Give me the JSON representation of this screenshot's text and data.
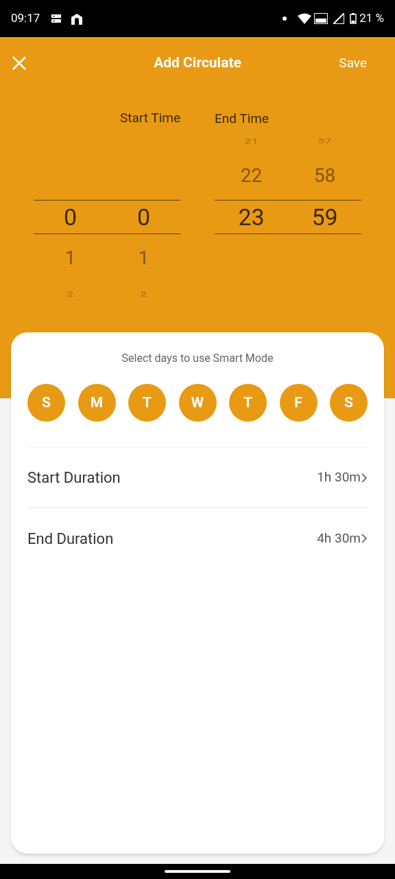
{
  "status_bar": {
    "time": "09:17",
    "battery": "21 %"
  },
  "header": {
    "title": "Add Circulate",
    "save": "Save"
  },
  "start_time": {
    "label": "Start Time",
    "columns": [
      {
        "selected": "0",
        "below": [
          "1",
          "2"
        ]
      },
      {
        "selected": "0",
        "below": [
          "1",
          "2"
        ]
      }
    ]
  },
  "end_time": {
    "label": "End Time",
    "columns": [
      {
        "above": [
          "21",
          "22"
        ],
        "selected": "23"
      },
      {
        "above": [
          "57",
          "58"
        ],
        "selected": "59"
      }
    ]
  },
  "card": {
    "prompt": "Select days to use Smart Mode",
    "days": [
      {
        "label": "S",
        "selected": true
      },
      {
        "label": "M",
        "selected": true
      },
      {
        "label": "T",
        "selected": true
      },
      {
        "label": "W",
        "selected": true
      },
      {
        "label": "T",
        "selected": true
      },
      {
        "label": "F",
        "selected": true
      },
      {
        "label": "S",
        "selected": true
      }
    ],
    "rows": [
      {
        "label": "Start Duration",
        "value": "1h 30m"
      },
      {
        "label": "End Duration",
        "value": "4h 30m"
      }
    ]
  }
}
